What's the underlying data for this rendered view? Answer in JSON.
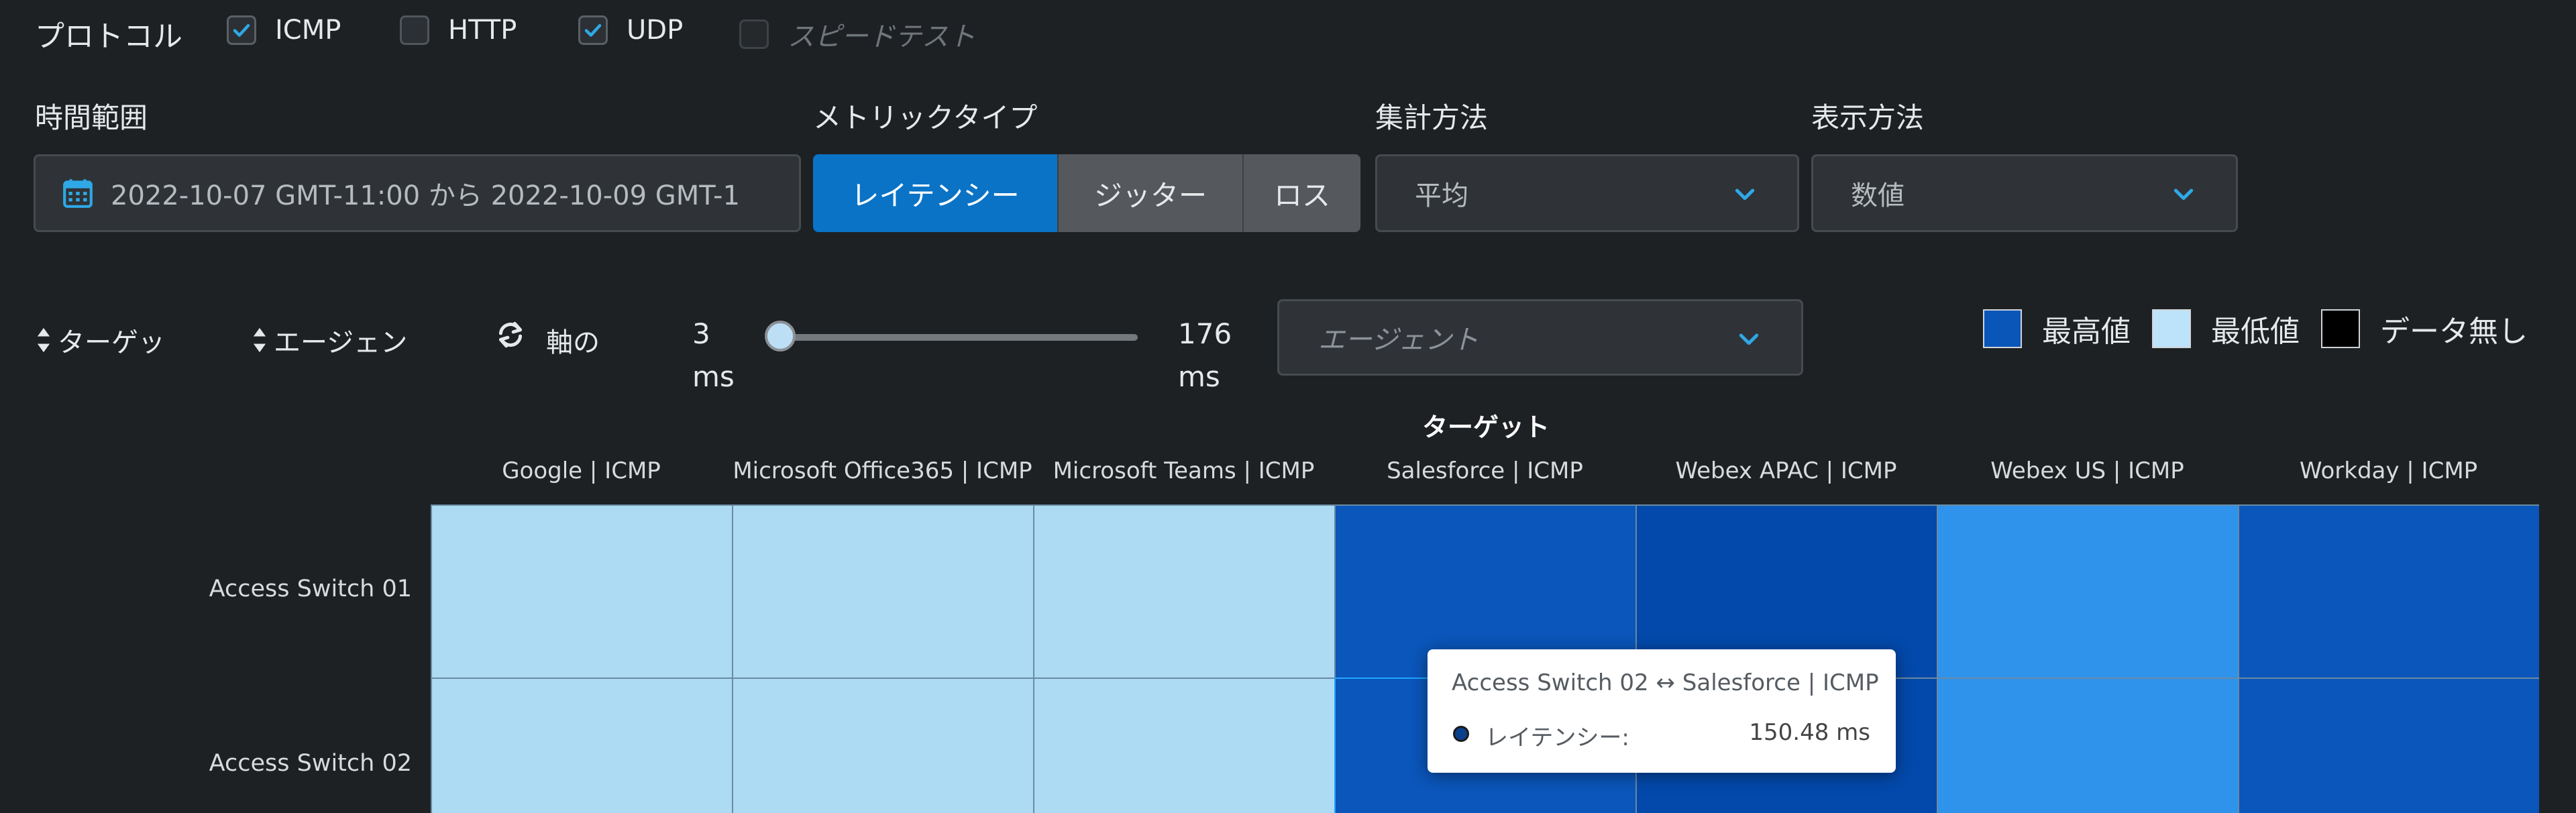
{
  "protocol": {
    "label": "プロトコル",
    "options": [
      {
        "label": "ICMP",
        "checked": true
      },
      {
        "label": "HTTP",
        "checked": false
      },
      {
        "label": "UDP",
        "checked": true
      },
      {
        "label": "スピードテスト",
        "checked": false,
        "disabled": true
      }
    ]
  },
  "time_range": {
    "label": "時間範囲",
    "value": "2022-10-07 GMT-11:00 から 2022-10-09 GMT-1"
  },
  "metric_type": {
    "label": "メトリックタイプ",
    "options": [
      "レイテンシー",
      "ジッター",
      "ロス"
    ],
    "selected": "レイテンシー"
  },
  "aggregation": {
    "label": "集計方法",
    "value": "平均"
  },
  "display": {
    "label": "表示方法",
    "value": "数値"
  },
  "sort": {
    "target_label": "ターゲッ",
    "agent_label": "エージェン",
    "axis_label": "軸の"
  },
  "slider": {
    "min_value": "3",
    "min_unit": "ms",
    "max_value": "176",
    "max_unit": "ms",
    "position": 0.0
  },
  "agent_select": {
    "placeholder": "エージェント"
  },
  "legend": [
    {
      "label": "最高値",
      "color": "#0a55b8"
    },
    {
      "label": "最低値",
      "color": "#bde3fa"
    },
    {
      "label": "データ無し",
      "color": "#000000"
    }
  ],
  "heatmap": {
    "title": "ターゲット",
    "columns": [
      "Google | ICMP",
      "Microsoft Office365 | ICMP",
      "Microsoft Teams | ICMP",
      "Salesforce | ICMP",
      "Webex APAC | ICMP",
      "Webex US | ICMP",
      "Workday | ICMP"
    ],
    "rows": [
      "Access Switch 01",
      "Access Switch 02"
    ],
    "cell_colors": [
      [
        "#acdbf3",
        "#acdbf3",
        "#acdbf3",
        "#0a56ba",
        "#0349ab",
        "#2f93ec",
        "#0a56ba"
      ],
      [
        "#acdbf3",
        "#acdbf3",
        "#acdbf3",
        "#0a56ba",
        "#0349ab",
        "#2f93ec",
        "#0a56ba"
      ]
    ]
  },
  "tooltip": {
    "title": "Access Switch 02 ↔ Salesforce | ICMP",
    "metric": "レイテンシー:",
    "value": "150.48 ms"
  }
}
